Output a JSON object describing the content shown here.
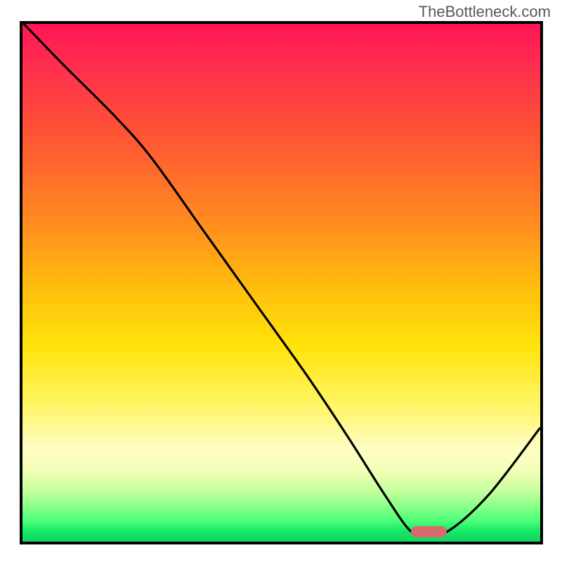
{
  "watermark": "TheBottleneck.com",
  "colors": {
    "frame": "#000000",
    "curve": "#000000",
    "marker": "#d86a6e"
  },
  "chart_data": {
    "type": "line",
    "title": "",
    "xlabel": "",
    "ylabel": "",
    "xlim": [
      0,
      100
    ],
    "ylim": [
      0,
      100
    ],
    "x": [
      0,
      8,
      18,
      25,
      35,
      45,
      55,
      63,
      70,
      75,
      78,
      82,
      90,
      100
    ],
    "values": [
      100,
      92,
      82,
      74,
      60,
      46,
      32,
      20,
      9,
      2,
      0,
      1,
      9,
      22
    ],
    "marker": {
      "x_start": 75,
      "x_end": 82,
      "y": 0
    },
    "note": "y = bottleneck percentage (higher = worse / red, 0 = green). Curve is the black line; marker is the flat red segment at the minimum."
  }
}
